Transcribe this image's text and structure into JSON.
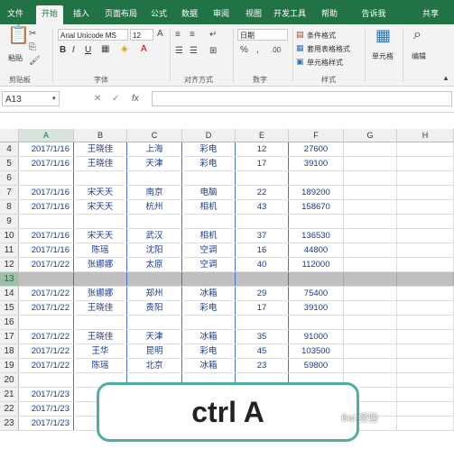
{
  "ribbon_tabs": [
    "文件",
    "开始",
    "插入",
    "页面布局",
    "公式",
    "数据",
    "审阅",
    "视图",
    "开发工具",
    "帮助",
    "告诉我",
    "共享"
  ],
  "ribbon": {
    "clipboard_label": "剪贴板",
    "paste_label": "粘贴",
    "font_name": "Arial Unicode MS",
    "font_size": "12",
    "font_label": "字体",
    "bold": "B",
    "italic": "I",
    "underline": "U",
    "align_label": "对齐方式",
    "number_format": "日期",
    "number_label": "数字",
    "cond_format": "条件格式",
    "table_format": "套用表格格式",
    "cell_style": "单元格样式",
    "styles_label": "样式",
    "cells_label": "单元格",
    "editing_label": "编辑"
  },
  "formula_bar": {
    "name_box": "A13",
    "fx": "fx",
    "formula": ""
  },
  "columns": [
    "A",
    "B",
    "C",
    "D",
    "E",
    "F",
    "G",
    "H"
  ],
  "rows": [
    {
      "num": "4",
      "cells": [
        "2017/1/16",
        "王晓佳",
        "上海",
        "彩电",
        "12",
        "27600"
      ]
    },
    {
      "num": "5",
      "cells": [
        "2017/1/16",
        "王晓佳",
        "天津",
        "彩电",
        "17",
        "39100"
      ]
    },
    {
      "num": "6",
      "cells": [
        "",
        "",
        "",
        "",
        "",
        ""
      ]
    },
    {
      "num": "7",
      "cells": [
        "2017/1/16",
        "宋天天",
        "南京",
        "电脑",
        "22",
        "189200"
      ]
    },
    {
      "num": "8",
      "cells": [
        "2017/1/16",
        "宋天天",
        "杭州",
        "相机",
        "43",
        "158670"
      ]
    },
    {
      "num": "9",
      "cells": [
        "",
        "",
        "",
        "",
        "",
        ""
      ]
    },
    {
      "num": "10",
      "cells": [
        "2017/1/16",
        "宋天天",
        "武汉",
        "相机",
        "37",
        "136530"
      ]
    },
    {
      "num": "11",
      "cells": [
        "2017/1/16",
        "陈瑶",
        "沈阳",
        "空调",
        "16",
        "44800"
      ]
    },
    {
      "num": "12",
      "cells": [
        "2017/1/22",
        "张娜娜",
        "太原",
        "空调",
        "40",
        "112000"
      ]
    },
    {
      "num": "13",
      "cells": [
        "",
        "",
        "",
        "",
        "",
        ""
      ],
      "selected": true
    },
    {
      "num": "14",
      "cells": [
        "2017/1/22",
        "张娜娜",
        "郑州",
        "冰箱",
        "29",
        "75400"
      ]
    },
    {
      "num": "15",
      "cells": [
        "2017/1/22",
        "王晓佳",
        "贵阳",
        "彩电",
        "17",
        "39100"
      ]
    },
    {
      "num": "16",
      "cells": [
        "",
        "",
        "",
        "",
        "",
        ""
      ]
    },
    {
      "num": "17",
      "cells": [
        "2017/1/22",
        "王晓佳",
        "天津",
        "冰箱",
        "35",
        "91000"
      ]
    },
    {
      "num": "18",
      "cells": [
        "2017/1/22",
        "王华",
        "昆明",
        "彩电",
        "45",
        "103500"
      ]
    },
    {
      "num": "19",
      "cells": [
        "2017/1/22",
        "陈瑶",
        "北京",
        "冰箱",
        "23",
        "59800"
      ]
    },
    {
      "num": "20",
      "cells": [
        "",
        "",
        "",
        "",
        "",
        ""
      ]
    },
    {
      "num": "21",
      "cells": [
        "2017/1/23",
        "",
        "",
        "",
        "",
        ""
      ]
    },
    {
      "num": "22",
      "cells": [
        "2017/1/23",
        "",
        "",
        "",
        "",
        ""
      ]
    },
    {
      "num": "23",
      "cells": [
        "2017/1/23",
        "",
        "",
        "",
        "",
        ""
      ]
    }
  ],
  "overlay_text": "ctrl  A",
  "watermark": "Bai 经验"
}
